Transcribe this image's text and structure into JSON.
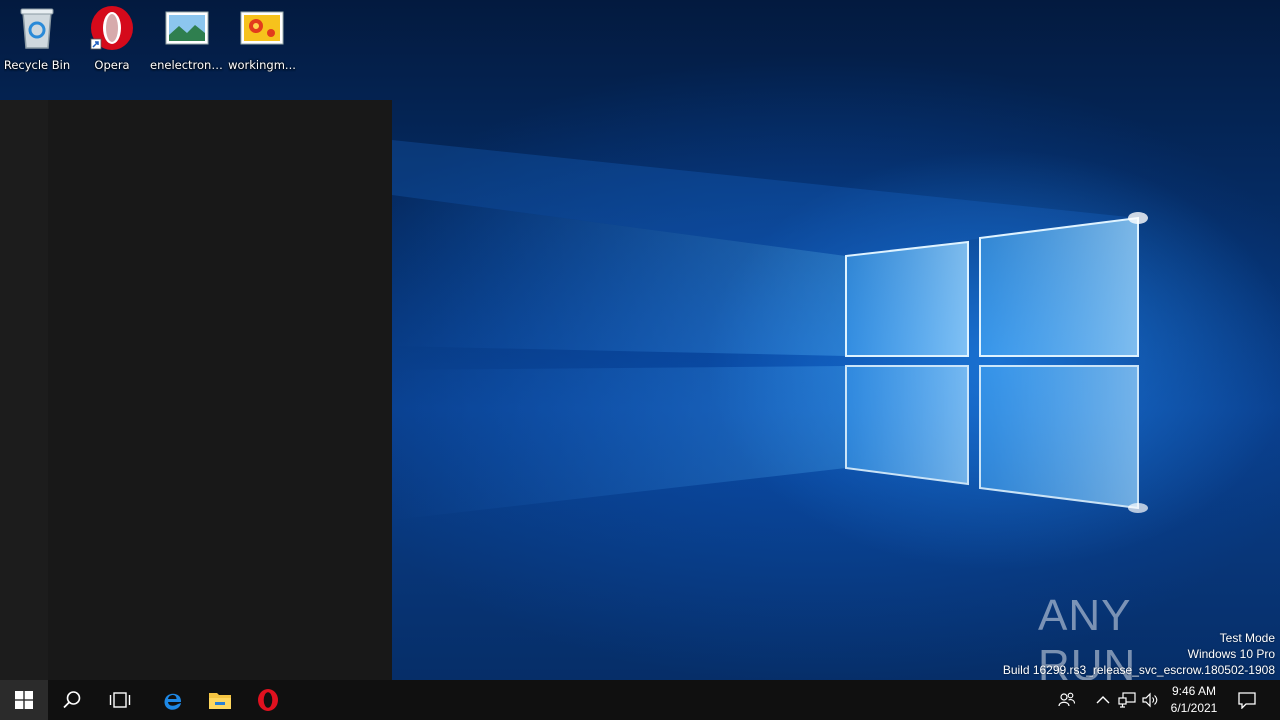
{
  "desktop": {
    "icons": [
      {
        "label": "Recycle Bin",
        "icon": "recycle-bin-icon"
      },
      {
        "label": "Opera",
        "icon": "opera-icon"
      },
      {
        "label": "enelectroni...",
        "icon": "image-file-icon"
      },
      {
        "label": "workingm...",
        "icon": "image-file-icon"
      }
    ]
  },
  "watermark": {
    "brand": "ANY RUN",
    "lines": [
      "Test Mode",
      "Windows 10 Pro",
      "Build 16299.rs3_release_svc_escrow.180502-1908"
    ]
  },
  "taskbar": {
    "buttons": [
      "start-icon",
      "search-icon",
      "task-view-icon",
      "edge-icon",
      "file-explorer-icon",
      "opera-icon"
    ],
    "tray_icons": [
      "people-icon",
      "chevron-up-icon",
      "network-icon",
      "volume-icon",
      "action-center-icon"
    ],
    "clock": {
      "time": "9:46 AM",
      "date": "6/1/2021"
    }
  },
  "colors": {
    "accent": "#0078d7",
    "taskbar": "#101010",
    "start_panel": "#181818"
  }
}
